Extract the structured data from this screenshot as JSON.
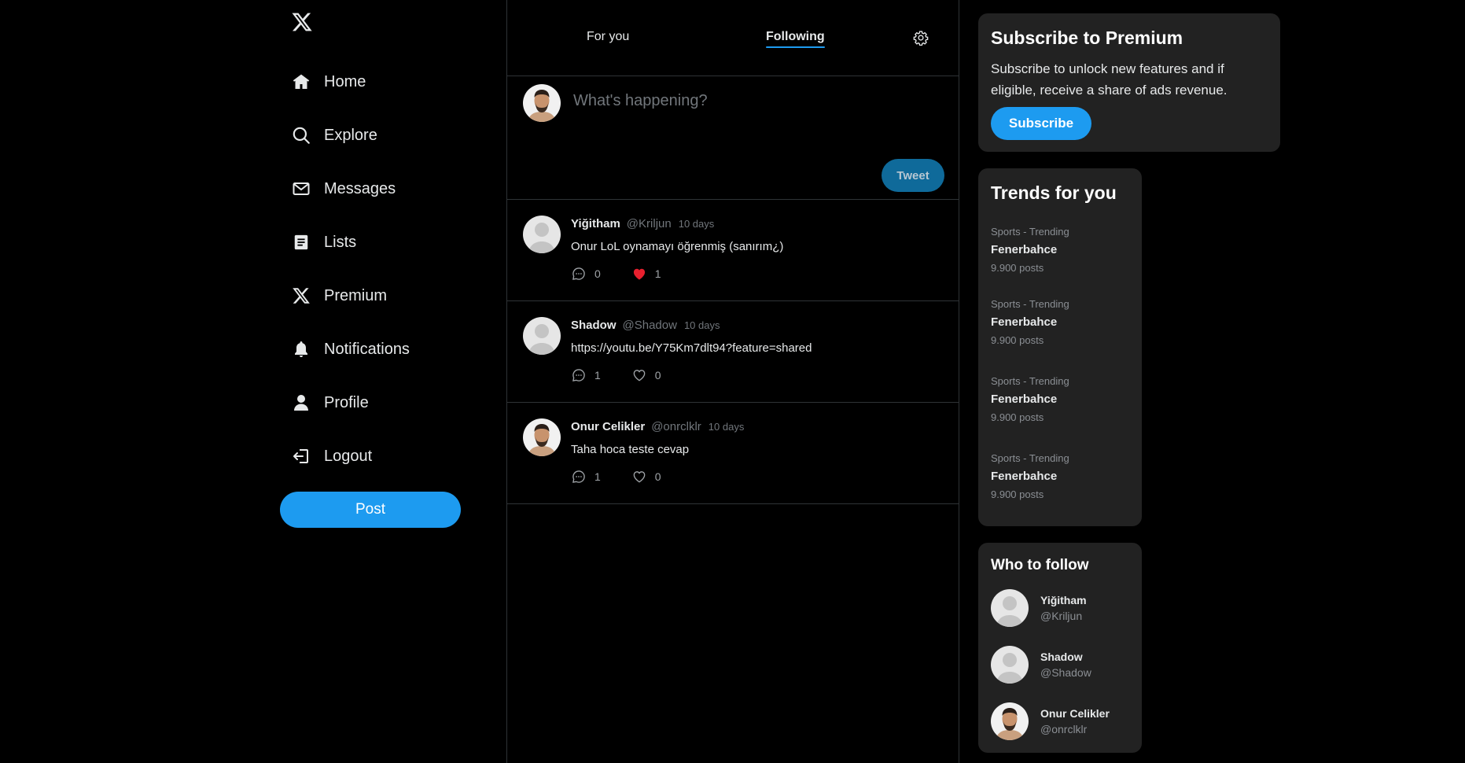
{
  "nav": {
    "items": [
      {
        "label": "Home",
        "icon": "home-icon"
      },
      {
        "label": "Explore",
        "icon": "search-icon"
      },
      {
        "label": "Messages",
        "icon": "mail-icon"
      },
      {
        "label": "Lists",
        "icon": "list-icon"
      },
      {
        "label": "Premium",
        "icon": "x-logo-icon"
      },
      {
        "label": "Notifications",
        "icon": "bell-icon"
      },
      {
        "label": "Profile",
        "icon": "user-icon"
      },
      {
        "label": "Logout",
        "icon": "logout-icon"
      }
    ],
    "post_label": "Post"
  },
  "feed": {
    "tabs": {
      "for_you": "For you",
      "following": "Following"
    },
    "composer": {
      "placeholder": "What's happening?",
      "tweet_label": "Tweet"
    },
    "tweets": [
      {
        "name": "Yiğitham",
        "handle": "@Kriljun",
        "time": "10 days",
        "text": "Onur LoL oynamayı öğrenmiş (sanırım¿)",
        "replies": "0",
        "likes": "1",
        "liked": true,
        "avatar": "default"
      },
      {
        "name": "Shadow",
        "handle": "@Shadow",
        "time": "10 days",
        "text": "https://youtu.be/Y75Km7dlt94?feature=shared",
        "replies": "1",
        "likes": "0",
        "liked": false,
        "avatar": "default"
      },
      {
        "name": "Onur Celikler",
        "handle": "@onrclklr",
        "time": "10 days",
        "text": "Taha hoca teste cevap",
        "replies": "1",
        "likes": "0",
        "liked": false,
        "avatar": "photo"
      }
    ]
  },
  "premium": {
    "title": "Subscribe to Premium",
    "text": "Subscribe to unlock new features and if eligible, receive a share of ads revenue.",
    "button": "Subscribe"
  },
  "trends": {
    "title": "Trends for you",
    "items": [
      {
        "category": "Sports - Trending",
        "name": "Fenerbahce",
        "posts": "9.900 posts"
      },
      {
        "category": "Sports - Trending",
        "name": "Fenerbahce",
        "posts": "9.900 posts"
      },
      {
        "category": "Sports - Trending",
        "name": "Fenerbahce",
        "posts": "9.900 posts"
      },
      {
        "category": "Sports - Trending",
        "name": "Fenerbahce",
        "posts": "9.900 posts"
      }
    ]
  },
  "who_to_follow": {
    "title": "Who to follow",
    "users": [
      {
        "name": "Yiğitham",
        "handle": "@Kriljun",
        "avatar": "default"
      },
      {
        "name": "Shadow",
        "handle": "@Shadow",
        "avatar": "default"
      },
      {
        "name": "Onur Celikler",
        "handle": "@onrclklr",
        "avatar": "photo"
      }
    ]
  },
  "colors": {
    "accent": "#1d9bf0",
    "background": "#000000",
    "card": "#222222",
    "like_active": "#f91880"
  }
}
